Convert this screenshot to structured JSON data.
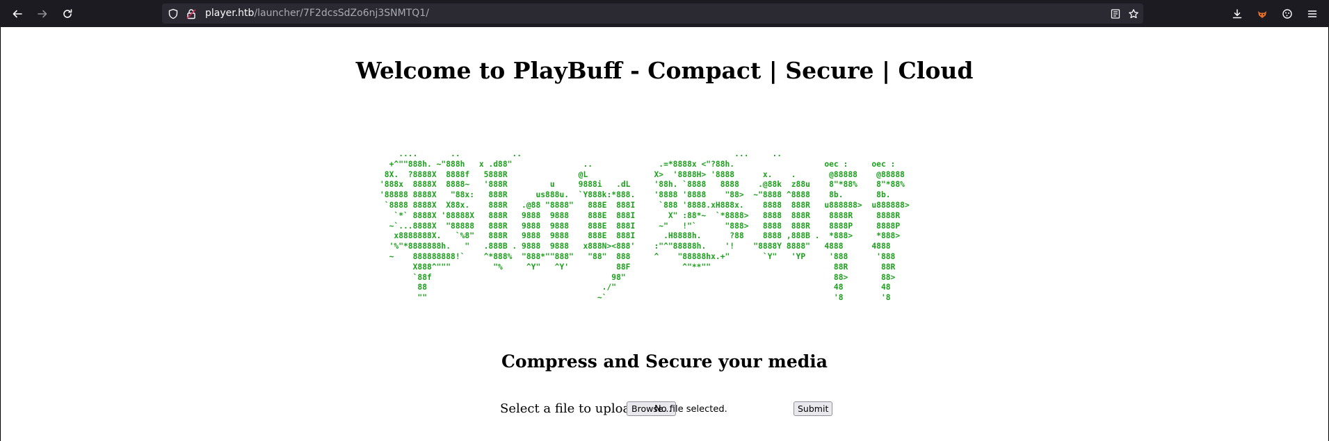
{
  "browser": {
    "url_host": "player.htb",
    "url_path": "/launcher/7F2dcsSdZo6nj3SNMTQ1/",
    "icons": [
      "back-arrow-icon",
      "forward-arrow-icon",
      "reload-icon",
      "shield-icon",
      "lock-warning-icon",
      "reader-mode-icon",
      "bookmark-star-icon",
      "downloads-icon",
      "extension-fox-icon",
      "extension-cookie-icon",
      "menu-icon"
    ],
    "colors": {
      "toolbar_bg": "#1c1b22",
      "urlbar_bg": "#2b2a33",
      "url_text": "#fbfbfe"
    }
  },
  "page": {
    "title": "Welcome to PlayBuff - Compact | Secure | Cloud",
    "ascii_art": "    ....       ..           ..                                             ...     ..\n  +^\"\"888h. ~\"888h   x .d88\"               ..              .=*8888x <\"?88h.                   oec :     oec :\n 8X.  ?8888X  8888f   5888R               @L              X>  '8888H> '8888      x.    .       @88888    @88888\n'888x  8888X  8888~   '888R         u     9888i   .dL     '88h. `8888   8888    .@88k  z88u    8\"*88%    8\"*88%\n'88888 8888X   \"88x:   888R      us888u.  `Y888k:*888.    '8888 '8888    \"88>  ~\"8888 ^8888    8b.       8b.\n `8888 8888X  X88x.    888R   .@88 \"8888\"   888E  888I     `888 '8888.xH888x.    8888  888R   u888888>  u888888>\n   `*` 8888X '88888X   888R   9888  9888    888E  888I       X\" :88*~  `*8888>   8888  888R    8888R     8888R\n  ~`...8888X  \"88888   888R   9888  9888    888E  888I     ~\"   !\"`      \"888>   8888  888R    8888P     8888P\n   x8888888X.   `%8\"   888R   9888  9888    888E  888I      .H8888h.      ?88    8888 ,888B .  *888>     *888>\n  '%\"*8888888h.   \"   .888B . 9888  9888   x888N><888'    :\"^\"88888h.    '!    \"8888Y 8888\"   4888      4888\n  ~    888888888!`    ^*888%  \"888*\"\"888\"   \"88\"  888     ^    \"88888hx.+\"       `Y\"   'YP     '888      '888\n       X888^\"\"\"         \"%     ^Y\"   ^Y'          88F           ^\"**\"\"                          88R       88R\n       `88f                                      98\"                                            88>       88>\n        88                                     ./\"                                              48        48\n        \"\"                                    ~`                                                '8        '8",
    "subtitle": "Compress and Secure your media",
    "upload_label": "Select a file to upload",
    "browse_label": "Browse...",
    "file_status": "No file selected.",
    "submit_label": "Submit",
    "colors": {
      "ascii": "#1ca01c"
    }
  }
}
